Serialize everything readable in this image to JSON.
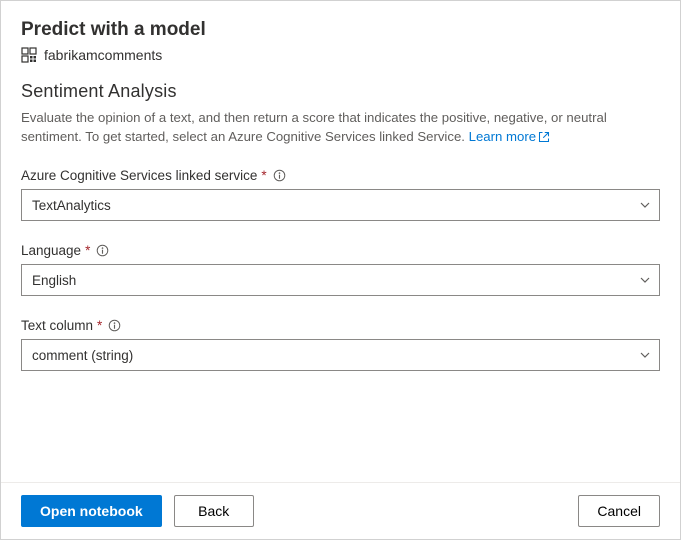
{
  "header": {
    "title": "Predict with a model",
    "resource_name": "fabrikamcomments"
  },
  "section": {
    "title": "Sentiment Analysis",
    "description": "Evaluate the opinion of a text, and then return a score that indicates the positive, negative, or neutral sentiment. To get started, select an Azure Cognitive Services linked Service. ",
    "learn_more_label": "Learn more"
  },
  "fields": {
    "linked_service": {
      "label": "Azure Cognitive Services linked service",
      "value": "TextAnalytics"
    },
    "language": {
      "label": "Language",
      "value": "English"
    },
    "text_column": {
      "label": "Text column",
      "value": "comment (string)"
    }
  },
  "footer": {
    "open_notebook": "Open notebook",
    "back": "Back",
    "cancel": "Cancel"
  }
}
